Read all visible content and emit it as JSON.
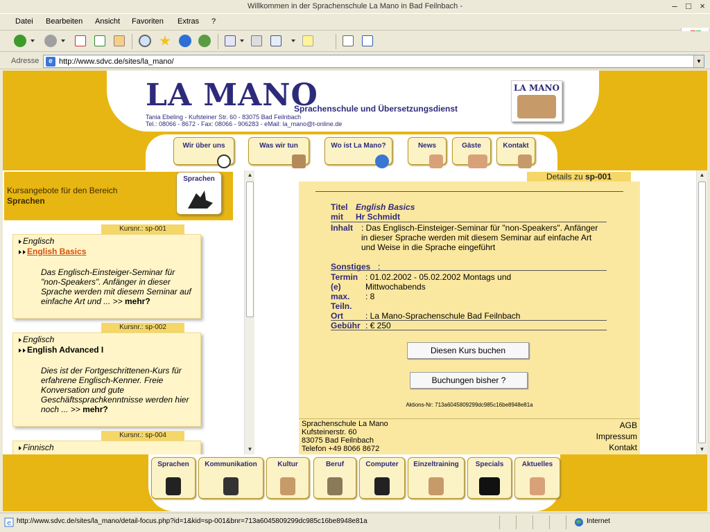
{
  "window": {
    "title": "Willkommen in der Sprachenschule La Mano in Bad Feilnbach -"
  },
  "menu": [
    "Datei",
    "Bearbeiten",
    "Ansicht",
    "Favoriten",
    "Extras",
    "?"
  ],
  "address": {
    "label": "Adresse",
    "url": "http://www.sdvc.de/sites/la_mano/"
  },
  "header": {
    "logo": "LA MANO",
    "tagline": "Sprachenschule und Übersetzungsdienst",
    "address_line1": "Tania Ebeling - Kufsteiner Str. 60 - 83075 Bad Feilnbach",
    "address_line2": "Tel.: 08066 - 8672 - Fax: 08066 - 906283 - eMail: la_mano@t-online.de",
    "corner_logo": "LA MANO"
  },
  "nav_top": [
    "Wir über uns",
    "Was wir tun",
    "Wo ist La Mano?",
    "News",
    "Gäste",
    "Kontakt"
  ],
  "left": {
    "heading_line1": "Kursangebote für den Bereich",
    "heading_line2": "Sprachen",
    "category_button": "Sprachen",
    "courses": [
      {
        "tag": "Kursnr.: sp-001",
        "lang": "Englisch",
        "title": "English Basics",
        "desc": "Das Englisch-Einsteiger-Seminar für \"non-Speakers\". Anfänger in dieser Sprache werden mit diesem Seminar auf einfache Art und ... >>",
        "more": "mehr?"
      },
      {
        "tag": "Kursnr.: sp-002",
        "lang": "Englisch",
        "title": "English Advanced I",
        "desc": "Dies ist der Fortgeschrittenen-Kurs für erfahrene Englisch-Kenner. Freie Konversation und gute Geschäftssprachkenntnisse werden hier noch ... >>",
        "more": "mehr?"
      },
      {
        "tag": "Kursnr.: sp-004",
        "lang": "Finnisch",
        "title": "",
        "desc": "",
        "more": ""
      }
    ]
  },
  "details": {
    "tag_prefix": "Details zu",
    "tag_id": "sp-001",
    "titel_label": "Titel",
    "titel": "English Basics",
    "mit_label": "mit",
    "mit": "Hr Schmidt",
    "inhalt_label": "Inhalt",
    "inhalt": ": Das Englisch-Einsteiger-Seminar für \"non-Speakers\". Anfänger in dieser Sprache werden mit diesem Seminar auf einfache Art und Weise in die Sprache eingeführt",
    "sonstiges_label": "Sonstiges",
    "sonstiges": ":",
    "termin_label": "Termin (e)",
    "termin": ": 01.02.2002 - 05.02.2002 Montags und Mittwochabends",
    "max_label": "max. Teiln.",
    "max": ": 8",
    "ort_label": "Ort",
    "ort": ": La Mano-Sprachenschule Bad Feilnbach",
    "gebuehr_label": "Gebühr",
    "gebuehr": ": € 250",
    "book_button": "Diesen Kurs buchen",
    "bookings_button": "Buchungen bisher ?",
    "aktions": "Aktions-Nr: 713a6045809299dc985c16be8948e81a",
    "footer_address": [
      "Sprachenschule La Mano",
      "Kufsteinerstr. 60",
      "83075 Bad Feilnbach",
      "Telefon +49 8066 8672"
    ],
    "footer_links": [
      "AGB",
      "Impressum",
      "Kontakt"
    ]
  },
  "nav_bottom": [
    "Sprachen",
    "Kommunikation",
    "Kultur",
    "Beruf",
    "Computer",
    "Einzeltraining",
    "Specials",
    "Aktuelles"
  ],
  "status": {
    "url": "http://www.sdvc.de/sites/la_mano/detail-focus.php?id=1&kid=sp-001&bnr=713a6045809299dc985c16be8948e81a",
    "zone": "Internet"
  },
  "colors": {
    "page_bg": "#e8b612",
    "card_bg": "#fff5c8",
    "detail_bg": "#fbe8a0",
    "brand": "#2e2a7a",
    "active_link": "#d4520e"
  }
}
